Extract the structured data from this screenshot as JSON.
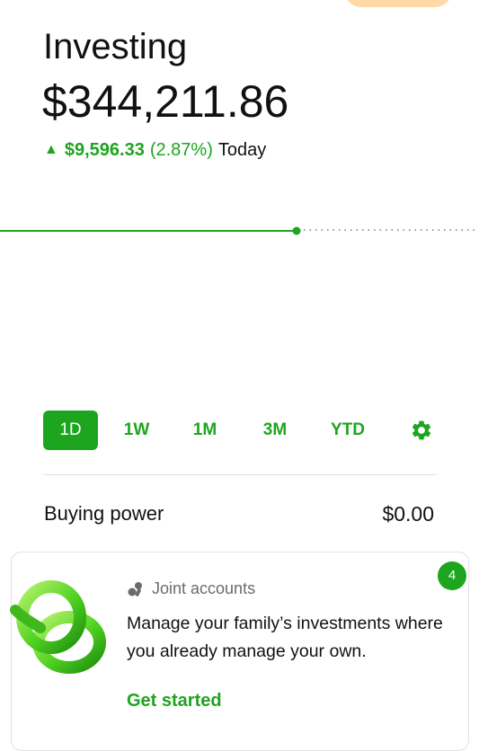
{
  "header": {
    "title": "Investing",
    "portfolio_value": "$344,211.86",
    "change": {
      "direction_icon": "triangle-up-icon",
      "amount": "$9,596.33",
      "percent": "(2.87%)",
      "period": "Today"
    }
  },
  "colors": {
    "accent": "#1da51f",
    "text": "#111111",
    "muted": "#6b6b6b",
    "divider": "#e3e3e3",
    "top_pill": "#ffd9a8"
  },
  "chart": {
    "line": "flat",
    "current_point": "dot",
    "remaining_day": "dotted"
  },
  "range_tabs": [
    {
      "label": "1D",
      "active": true
    },
    {
      "label": "1W",
      "active": false
    },
    {
      "label": "1M",
      "active": false
    },
    {
      "label": "3M",
      "active": false
    },
    {
      "label": "YTD",
      "active": false
    }
  ],
  "settings_icon": "gear-icon",
  "buying_power": {
    "label": "Buying power",
    "value": "$0.00"
  },
  "promo_card": {
    "badge": "4",
    "tag_icon": "joint-accounts-icon",
    "tag": "Joint accounts",
    "body": "Manage your family’s investments where you already manage your own.",
    "cta": "Get started",
    "illustration": "linked-rings-illustration"
  }
}
